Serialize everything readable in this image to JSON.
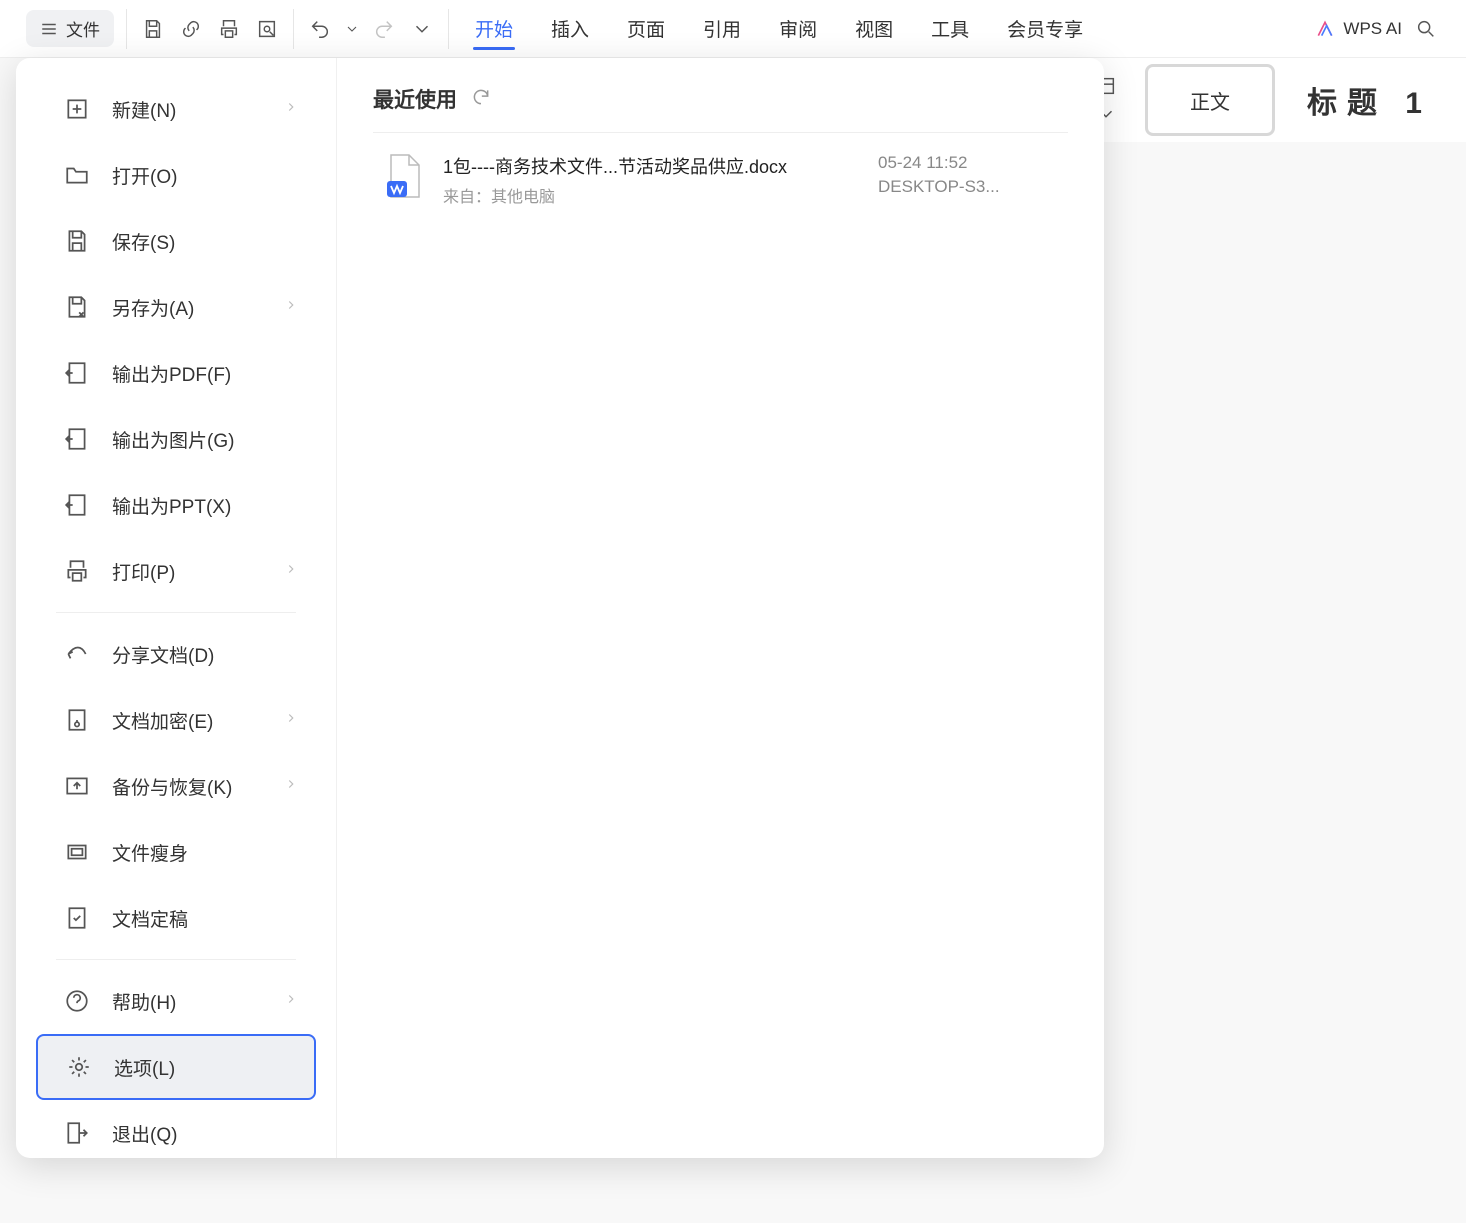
{
  "toolbar": {
    "file_label": "文件",
    "tabs": [
      "开始",
      "插入",
      "页面",
      "引用",
      "审阅",
      "视图",
      "工具",
      "会员专享"
    ],
    "active_tab_index": 0,
    "ai_label": "WPS AI"
  },
  "styles": {
    "normal": "正文",
    "heading": "标题  1"
  },
  "file_menu": {
    "items": [
      {
        "id": "new",
        "label": "新建(N)",
        "arrow": true
      },
      {
        "id": "open",
        "label": "打开(O)",
        "arrow": false
      },
      {
        "id": "save",
        "label": "保存(S)",
        "arrow": false
      },
      {
        "id": "saveas",
        "label": "另存为(A)",
        "arrow": true
      },
      {
        "id": "pdf",
        "label": "输出为PDF(F)",
        "arrow": false
      },
      {
        "id": "image",
        "label": "输出为图片(G)",
        "arrow": false
      },
      {
        "id": "ppt",
        "label": "输出为PPT(X)",
        "arrow": false
      },
      {
        "id": "print",
        "label": "打印(P)",
        "arrow": true
      },
      {
        "sep": true
      },
      {
        "id": "share",
        "label": "分享文档(D)",
        "arrow": false
      },
      {
        "id": "encrypt",
        "label": "文档加密(E)",
        "arrow": true
      },
      {
        "id": "backup",
        "label": "备份与恢复(K)",
        "arrow": true
      },
      {
        "id": "slim",
        "label": "文件瘦身",
        "arrow": false
      },
      {
        "id": "finalize",
        "label": "文档定稿",
        "arrow": false
      },
      {
        "sep": true
      },
      {
        "id": "help",
        "label": "帮助(H)",
        "arrow": true
      },
      {
        "id": "options",
        "label": "选项(L)",
        "arrow": false,
        "selected": true
      },
      {
        "id": "exit",
        "label": "退出(Q)",
        "arrow": false
      }
    ]
  },
  "recent": {
    "title": "最近使用",
    "docs": [
      {
        "name": "1包----商务技术文件...节活动奖品供应.docx",
        "from": "来自：其他电脑",
        "time": "05-24 11:52",
        "machine": "DESKTOP-S3..."
      }
    ]
  }
}
